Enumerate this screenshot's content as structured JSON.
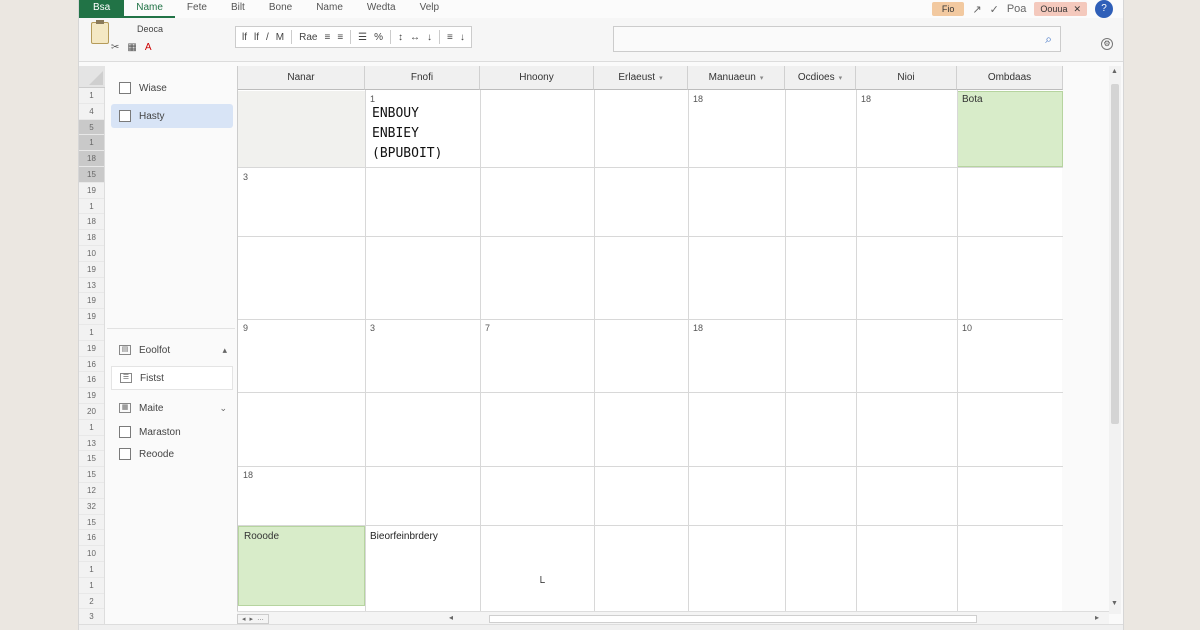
{
  "menu": {
    "file": "Bsa",
    "items": [
      "Name",
      "Fete",
      "Bilt",
      "Bone",
      "Name",
      "Wedta",
      "Velp"
    ],
    "active_index": 0
  },
  "header_right": {
    "share_label": "Fio",
    "tab_label": "Poa",
    "account_label": "Oouua",
    "avatar_initial": "?"
  },
  "ribbon": {
    "clipboard_label": "Deoca",
    "font_items": [
      "lf",
      "lf",
      "/",
      "M",
      "Rae"
    ]
  },
  "nav": {
    "top": [
      {
        "label": "Wiase",
        "selected": false
      },
      {
        "label": "Hasty",
        "selected": true
      }
    ],
    "bottom": [
      {
        "label": "Eoolfot",
        "icon": "table-icon"
      },
      {
        "label": "Fistst",
        "icon": "list-icon"
      },
      {
        "label": "Maite",
        "icon": "grid-icon"
      },
      {
        "label": "Maraston",
        "icon": "checkbox"
      },
      {
        "label": "Reoode",
        "icon": "checkbox"
      }
    ]
  },
  "row_numbers": [
    "",
    "1",
    "4",
    "5",
    "1",
    "18",
    "15",
    "19",
    "1",
    "18",
    "18",
    "10",
    "19",
    "13",
    "19",
    "19",
    "1",
    "19",
    "16",
    "16",
    "19",
    "20",
    "1",
    "13",
    "15",
    "15",
    "12",
    "32",
    "15",
    "16",
    "10",
    "1",
    "1",
    "2",
    "3"
  ],
  "grid": {
    "columns": [
      "Nanar",
      "Fnofi",
      "Hnoony",
      "Erlaeust",
      "Manuaeun",
      "Ocdioes",
      "Nioi",
      "Ombdaas"
    ],
    "cells": {
      "r1c2_num": "1",
      "big_text": [
        "ENBOUY",
        "ENBIEY",
        "(BPUBOIT)"
      ],
      "r1c6_num": "18",
      "r1c8_num": "18",
      "r1c9_label": "Bota",
      "r2c1_num": "3",
      "r4c1_num": "9",
      "r4c2_num": "3",
      "r4c3_num": "7",
      "r4c5_num": "18",
      "r4c9_num": "10",
      "r6c1_num": "18",
      "bottom_green": "Rooode",
      "bottom_text": "Bieorfeinbrdery"
    }
  },
  "colors": {
    "file_tab": "#217346",
    "green_cell": "#d8ecc9",
    "avatar": "#2f5fb8"
  }
}
